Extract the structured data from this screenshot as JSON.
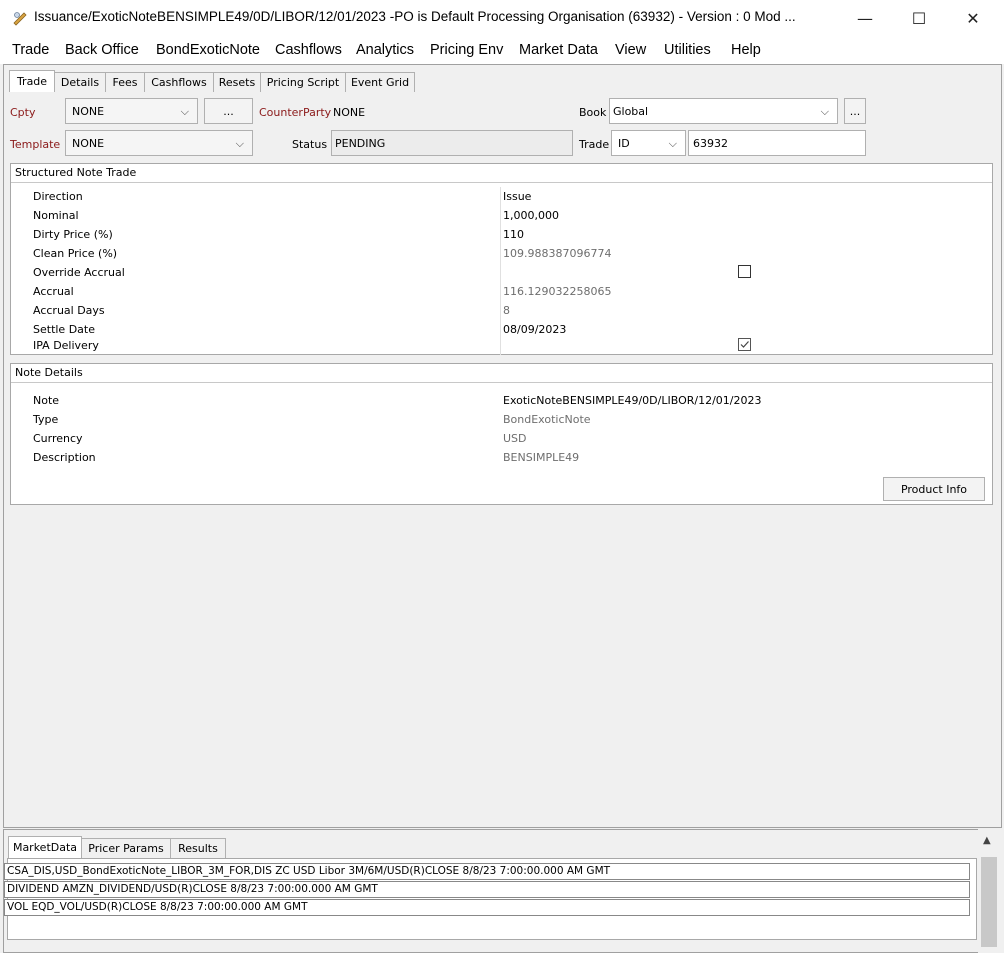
{
  "window": {
    "title": "Issuance/ExoticNoteBENSIMPLE49/0D/LIBOR/12/01/2023  -PO is Default Processing Organisation  (63932) - Version : 0 Mod ...",
    "minimize": "—",
    "maximize": "☐",
    "close": "✕"
  },
  "menu": [
    "Trade",
    "Back Office",
    "BondExoticNote",
    "Cashflows",
    "Analytics",
    "Pricing Env",
    "Market Data",
    "View",
    "Utilities",
    "Help"
  ],
  "tabs": [
    "Trade",
    "Details",
    "Fees",
    "Cashflows",
    "Resets",
    "Pricing Script",
    "Event Grid"
  ],
  "header": {
    "cpty_label": "Cpty",
    "cpty_value": "NONE",
    "ellipsis": "...",
    "counterparty_label": "CounterParty",
    "counterparty_value": "NONE",
    "book_label": "Book",
    "book_value": "Global",
    "template_label": "Template",
    "template_value": "NONE",
    "status_label": "Status",
    "status_value": "PENDING",
    "trade_label": "Trade",
    "trade_id_type": "ID",
    "trade_id_value": "63932"
  },
  "structured_note": {
    "title": "Structured Note Trade",
    "rows": [
      {
        "label": "Direction",
        "value": "Issue"
      },
      {
        "label": "Nominal",
        "value": "1,000,000"
      },
      {
        "label": "Dirty Price (%)",
        "value": "110"
      },
      {
        "label": "Clean Price (%)",
        "value": "109.988387096774"
      },
      {
        "label": "Override Accrual",
        "value": ""
      },
      {
        "label": "Accrual",
        "value": "116.129032258065"
      },
      {
        "label": "Accrual Days",
        "value": "8"
      },
      {
        "label": "Settle Date",
        "value": "08/09/2023"
      },
      {
        "label": "IPA Delivery",
        "value": ""
      }
    ],
    "override_accrual_checked": false,
    "ipa_delivery_checked": true
  },
  "note_details": {
    "title": "Note Details",
    "rows": [
      {
        "label": "Note",
        "value": "ExoticNoteBENSIMPLE49/0D/LIBOR/12/01/2023"
      },
      {
        "label": "Type",
        "value": "BondExoticNote"
      },
      {
        "label": "Currency",
        "value": "USD"
      },
      {
        "label": "Description",
        "value": "BENSIMPLE49"
      }
    ],
    "product_info_button": "Product Info"
  },
  "bottom_tabs": [
    "MarketData",
    "Pricer Params",
    "Results"
  ],
  "market_data": [
    "CSA_DIS,USD_BondExoticNote_LIBOR_3M_FOR,DIS   ZC USD Libor 3M/6M/USD(R)CLOSE 8/8/23 7:00:00.000 AM GMT",
    "DIVIDEND   AMZN_DIVIDEND/USD(R)CLOSE 8/8/23 7:00:00.000 AM GMT",
    "VOL   EQD_VOL/USD(R)CLOSE 8/8/23 7:00:00.000 AM GMT"
  ]
}
